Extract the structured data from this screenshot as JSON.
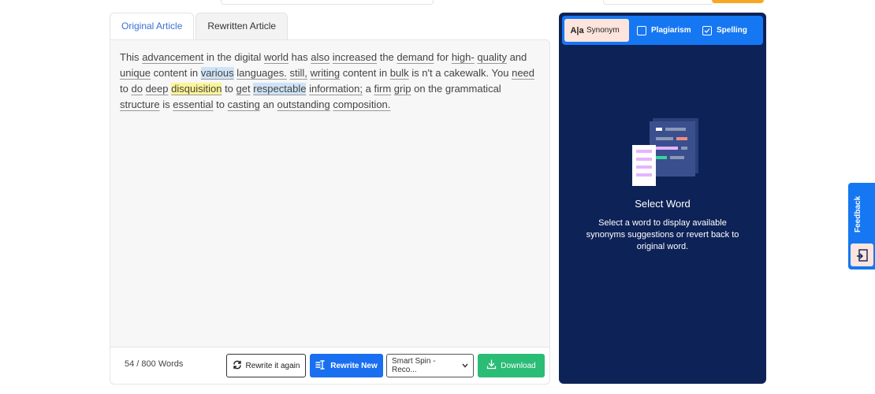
{
  "tabs": {
    "original": "Original Article",
    "rewritten": "Rewritten Article"
  },
  "article": {
    "words": [
      {
        "t": "This",
        "u": false
      },
      {
        "t": "advancement",
        "u": true
      },
      {
        "t": "in",
        "u": false
      },
      {
        "t": "the",
        "u": false
      },
      {
        "t": "digital",
        "u": false
      },
      {
        "t": "world",
        "u": true
      },
      {
        "t": "has",
        "u": false
      },
      {
        "t": "also",
        "u": true
      },
      {
        "t": "increased",
        "u": true
      },
      {
        "t": "the",
        "u": false
      },
      {
        "t": "demand",
        "u": true
      },
      {
        "t": "for",
        "u": false
      },
      {
        "t": "high-",
        "u": true
      },
      {
        "t": "quality",
        "u": true
      },
      {
        "t": "and",
        "u": false
      },
      {
        "t": "unique",
        "u": true
      },
      {
        "t": "content",
        "u": false
      },
      {
        "t": "in",
        "u": false
      },
      {
        "t": "various",
        "u": true,
        "hl": "blue"
      },
      {
        "t": "languages.",
        "u": true
      },
      {
        "t": "still,",
        "u": true
      },
      {
        "t": "writing",
        "u": true
      },
      {
        "t": "content",
        "u": false
      },
      {
        "t": "in",
        "u": false
      },
      {
        "t": "bulk",
        "u": true
      },
      {
        "t": "is",
        "u": false
      },
      {
        "t": "n't",
        "u": false
      },
      {
        "t": "a",
        "u": false
      },
      {
        "t": "cakewalk.",
        "u": false
      },
      {
        "t": "You",
        "u": false
      },
      {
        "t": "need",
        "u": true
      },
      {
        "t": "to",
        "u": false
      },
      {
        "t": "do",
        "u": true
      },
      {
        "t": "deep",
        "u": true
      },
      {
        "t": "disquisition",
        "u": true,
        "hl": "yellow"
      },
      {
        "t": "to",
        "u": false
      },
      {
        "t": "get",
        "u": true
      },
      {
        "t": "respectable",
        "u": true,
        "hl": "blue"
      },
      {
        "t": "information;",
        "u": true
      },
      {
        "t": "a",
        "u": false
      },
      {
        "t": "firm",
        "u": true
      },
      {
        "t": "grip",
        "u": true
      },
      {
        "t": "on",
        "u": false
      },
      {
        "t": "the",
        "u": false
      },
      {
        "t": "grammatical",
        "u": false
      },
      {
        "t": "structure",
        "u": true
      },
      {
        "t": "is",
        "u": false
      },
      {
        "t": "essential",
        "u": true
      },
      {
        "t": "to",
        "u": false
      },
      {
        "t": "casting",
        "u": true
      },
      {
        "t": "an",
        "u": false
      },
      {
        "t": "outstanding",
        "u": true
      },
      {
        "t": "composition.",
        "u": true
      }
    ]
  },
  "footer": {
    "word_count": "54 / 800 Words",
    "rewrite_again": "Rewrite it again",
    "rewrite_new": "Rewrite New",
    "spin_mode": "Smart Spin -Reco...",
    "download": "Download"
  },
  "side": {
    "tabs": {
      "synonym": "Synonym",
      "plagiarism": "Plagiarism",
      "spelling": "Spelling"
    },
    "title": "Select Word",
    "description": "Select a word to display available synonyms suggestions or revert back to original word."
  },
  "feedback": {
    "label": "Feedback"
  },
  "colors": {
    "accent": "#1677f2",
    "panel_bg": "#0d2257",
    "download_green": "#2bbc75",
    "highlight_blue": "#cfe3f8",
    "highlight_yellow": "#fcf596"
  }
}
